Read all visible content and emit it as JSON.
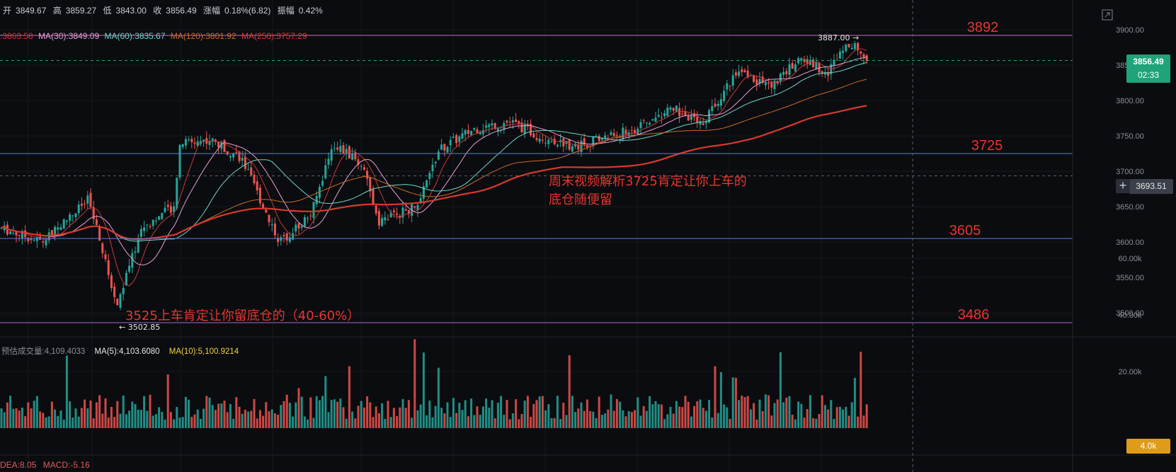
{
  "ohlc": {
    "open_label": "开",
    "open": "3849.67",
    "high_label": "高",
    "high": "3859.27",
    "low_label": "低",
    "low": "3843.00",
    "close_label": "收",
    "close": "3856.49",
    "change_label": "涨幅",
    "change": "0.18%(6.82)",
    "amplitude_label": "振幅",
    "amplitude": "0.42%"
  },
  "ma_row": {
    "ma15": ":3863.58",
    "ma30": "MA(30):3849.09",
    "ma60": "MA(60):3835.67",
    "ma120": "MA(120):3801.92",
    "ma250": "MA(250):3757.29"
  },
  "price_axis": {
    "labels": [
      "3900.00",
      "3850.00",
      "3800.00",
      "3750.00",
      "3700.00",
      "3650.00",
      "3600.00",
      "3550.00",
      "3500.00"
    ],
    "current_price": "3856.49",
    "countdown": "02:33",
    "crosshair_price": "3693.51",
    "crosshair_symbol": "+"
  },
  "volume_axis": {
    "labels": [
      "60.00k",
      "40.00k",
      "20.00k"
    ],
    "current_volume": "4.0k"
  },
  "volume_row": {
    "est": "预估成交量:4,109.4033",
    "ma5": "MA(5):4,103.6080",
    "ma10": "MA(10):5,100.9214"
  },
  "macd_row": {
    "dea": "DEA:8.05",
    "macd": "MACD:-5.16"
  },
  "levels": [
    {
      "price": 3892,
      "label": "3892",
      "color": "#c86bc8"
    },
    {
      "price": 3725,
      "label": "3725",
      "color": "#5b7fd6"
    },
    {
      "price": 3605,
      "label": "3605",
      "color": "#5b7fd6"
    },
    {
      "price": 3486,
      "label": "3486",
      "color": "#9b6bd6"
    }
  ],
  "annotations": {
    "top_marker": "3887.00 →",
    "low_marker": "← 3502.85",
    "note1": "3525上车肯定让你留底仓的（40-60%）",
    "note2_line1": "周末视频解析3725肯定让你上车的",
    "note2_line2": "底仓随便留"
  },
  "colors": {
    "background": "#0b0c0f",
    "up": "#26a69a",
    "down": "#ef5350",
    "annotation": "#e8352e",
    "current_price_tag": "#1fa37a",
    "volume_tag": "#e09b19",
    "ma30": "#e8a0d8",
    "ma60": "#6fd6c8",
    "ma120": "#c96a2c",
    "ma250": "#d83a2c"
  },
  "icons": {
    "expand": "expand-icon"
  }
}
